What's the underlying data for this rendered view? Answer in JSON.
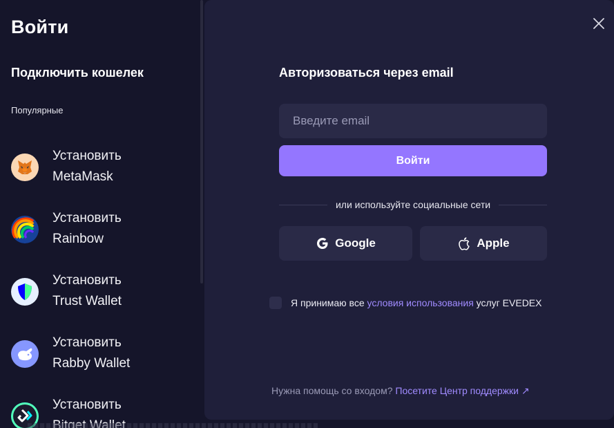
{
  "left": {
    "title": "Войти",
    "subtitle": "Подключить кошелек",
    "section_label": "Популярные",
    "wallets": [
      {
        "action": "Установить",
        "name": "MetaMask",
        "icon": "metamask-fox-icon"
      },
      {
        "action": "Установить",
        "name": "Rainbow",
        "icon": "rainbow-icon"
      },
      {
        "action": "Установить",
        "name": "Trust Wallet",
        "icon": "trust-shield-icon"
      },
      {
        "action": "Установить",
        "name": "Rabby Wallet",
        "icon": "rabby-bunny-icon"
      },
      {
        "action": "Установить",
        "name": "Bitget Wallet",
        "icon": "bitget-icon"
      }
    ]
  },
  "auth": {
    "title": "Авторизоваться через email",
    "email_placeholder": "Введите email",
    "email_value": "",
    "login_label": "Войти",
    "divider_text": "или используйте социальные сети",
    "google_label": "Google",
    "apple_label": "Apple",
    "terms_prefix": "Я принимаю все",
    "terms_link": "условия использования",
    "terms_suffix": "услуг EVEDEX",
    "help_text": "Нужна помощь со входом?",
    "help_link": "Посетите Центр поддержки ↗"
  },
  "colors": {
    "accent": "#9476ff",
    "link": "#a08bff",
    "panel_bg": "#1f1f3a",
    "sidebar_bg": "#15152a"
  }
}
